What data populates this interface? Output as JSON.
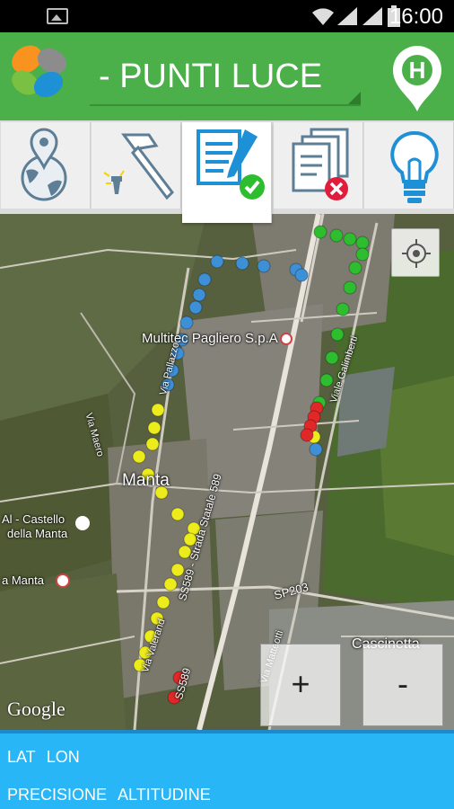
{
  "status_bar": {
    "time": "16:00",
    "icons": [
      "image-icon",
      "wifi-icon",
      "signal-icon",
      "signal-icon",
      "battery-icon"
    ]
  },
  "header": {
    "title": "- PUNTI LUCE",
    "home_pin_letter": "H"
  },
  "toolbar": {
    "tools": [
      {
        "icon": "globe-pin-icon"
      },
      {
        "icon": "hammer-icon"
      },
      {
        "icon": "edit-document-check-icon",
        "active": true
      },
      {
        "icon": "documents-delete-icon"
      },
      {
        "icon": "light-bulb-icon"
      }
    ]
  },
  "map": {
    "labels": {
      "company": "Multitec Pagliero S.p.A",
      "town": "Manta",
      "castle_line1": "Al - Castello",
      "castle_line2": "della Manta",
      "manta_poi": "a Manta",
      "hamlet": "Cascinetta",
      "road_sp203": "SP203",
      "road_ss589_top": "SS589 - Strada Statale 589",
      "road_ss589_bottom": "SS589",
      "via_maero": "Via Maero",
      "via_valerand": "Via Valerand",
      "via_galimberti": "Viale Galimberti",
      "via_matteotti": "Via Matteotti",
      "via_pallazzo": "Via Pallazzo"
    },
    "zoom_in": "+",
    "zoom_out": "-",
    "attribution": "Google",
    "colors": {
      "blue": "#3d8fd6",
      "green": "#2ebd2e",
      "yellow": "#ecec1c",
      "red": "#e02828"
    }
  },
  "info": {
    "lat_label": "LAT",
    "lon_label": "LON",
    "precision_label": "PRECISIONE",
    "altitude_label": "ALTITUDINE"
  }
}
